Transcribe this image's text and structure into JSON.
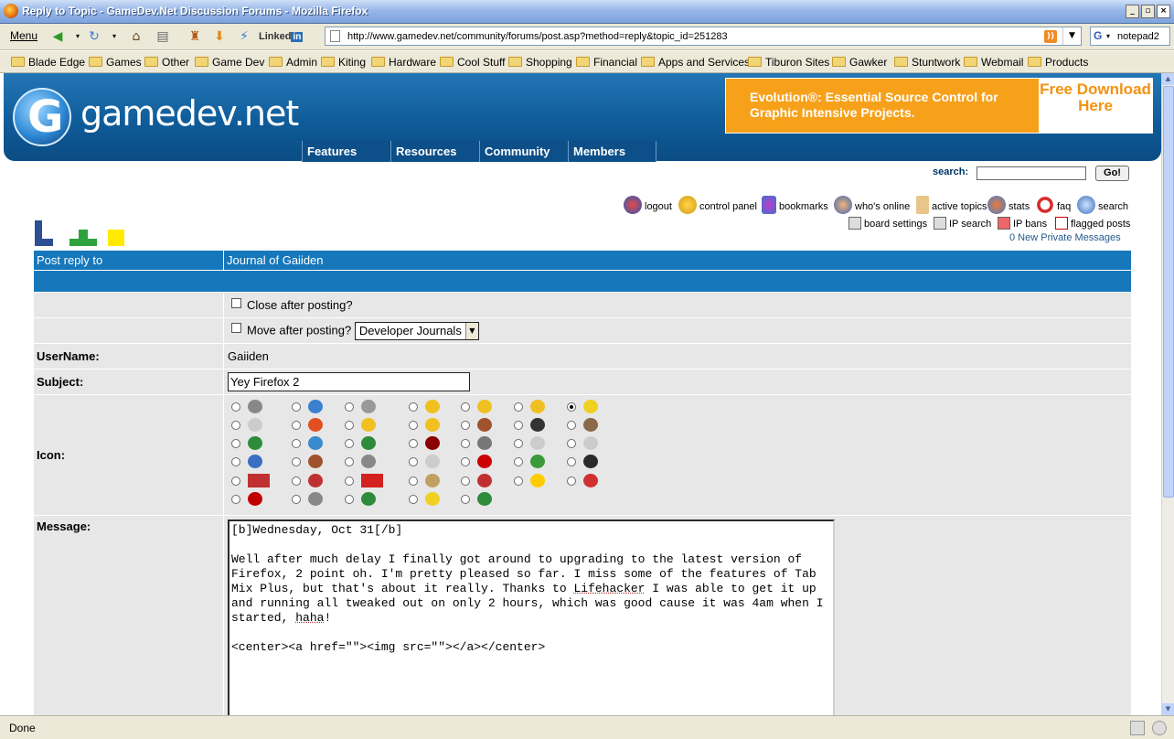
{
  "window": {
    "title": "Reply to Topic - GameDev.Net Discussion Forums - Mozilla Firefox",
    "min": "_",
    "max": "▫",
    "close": "×"
  },
  "nav": {
    "menu": "Menu",
    "linked": "Linked",
    "linked_in": "in",
    "url": "http://www.gamedev.net/community/forums/post.asp?method=reply&topic_id=251283",
    "search_engine": "G",
    "search_value": "notepad2"
  },
  "bookmarks": [
    "Blade Edge",
    "Games",
    "Other",
    "Game Dev",
    "Admin",
    "Kiting",
    "Hardware",
    "Cool Stuff",
    "Shopping",
    "Financial",
    "Apps and Services",
    "Tiburon Sites",
    "Gawker",
    "Stuntwork",
    "Webmail",
    "Products"
  ],
  "site": {
    "logo": "gamedev.net",
    "logo_glyph": "G",
    "ad_text": "Evolution®: Essential Source Control for Graphic Intensive Projects.",
    "ad_cta": "Free Download Here",
    "tabs": [
      "Features",
      "Resources",
      "Community",
      "Members"
    ],
    "search_label": "search:",
    "go": "Go!",
    "tools_row1": [
      "logout",
      "control panel",
      "bookmarks",
      "who's online",
      "active topics",
      "stats",
      "faq",
      "search"
    ],
    "tools_row2": [
      "board settings",
      "IP search",
      "IP bans",
      "flagged posts"
    ],
    "pm": "0 New Private Messages"
  },
  "form": {
    "post_reply_label": "Post reply to",
    "topic": "Journal of Gaiiden",
    "close_after": "Close after posting?",
    "move_after": "Move after posting?",
    "move_select": "Developer Journals",
    "username_label": "UserName:",
    "username": "Gaiiden",
    "subject_label": "Subject:",
    "subject": "Yey Firefox 2",
    "icon_label": "Icon:",
    "message_label": "Message:",
    "message_line1": "[b]Wednesday, Oct 31[/b]",
    "message_p1a": "Well after much delay I finally got around to upgrading to the latest version of Firefox, 2 point oh. I'm pretty pleased so far. I miss some of the features of Tab Mix Plus, but that's about it really. Thanks to ",
    "message_link": "Lifehacker",
    "message_p1b": " I was able to get it up and running all tweaked out on only 2 hours, which was good cause it was 4am when I started, ",
    "message_haha": "haha",
    "message_p1c": "!",
    "message_code": "<center><a href=\"\"><img src=\"\"></a></center>"
  },
  "status": {
    "text": "Done"
  }
}
